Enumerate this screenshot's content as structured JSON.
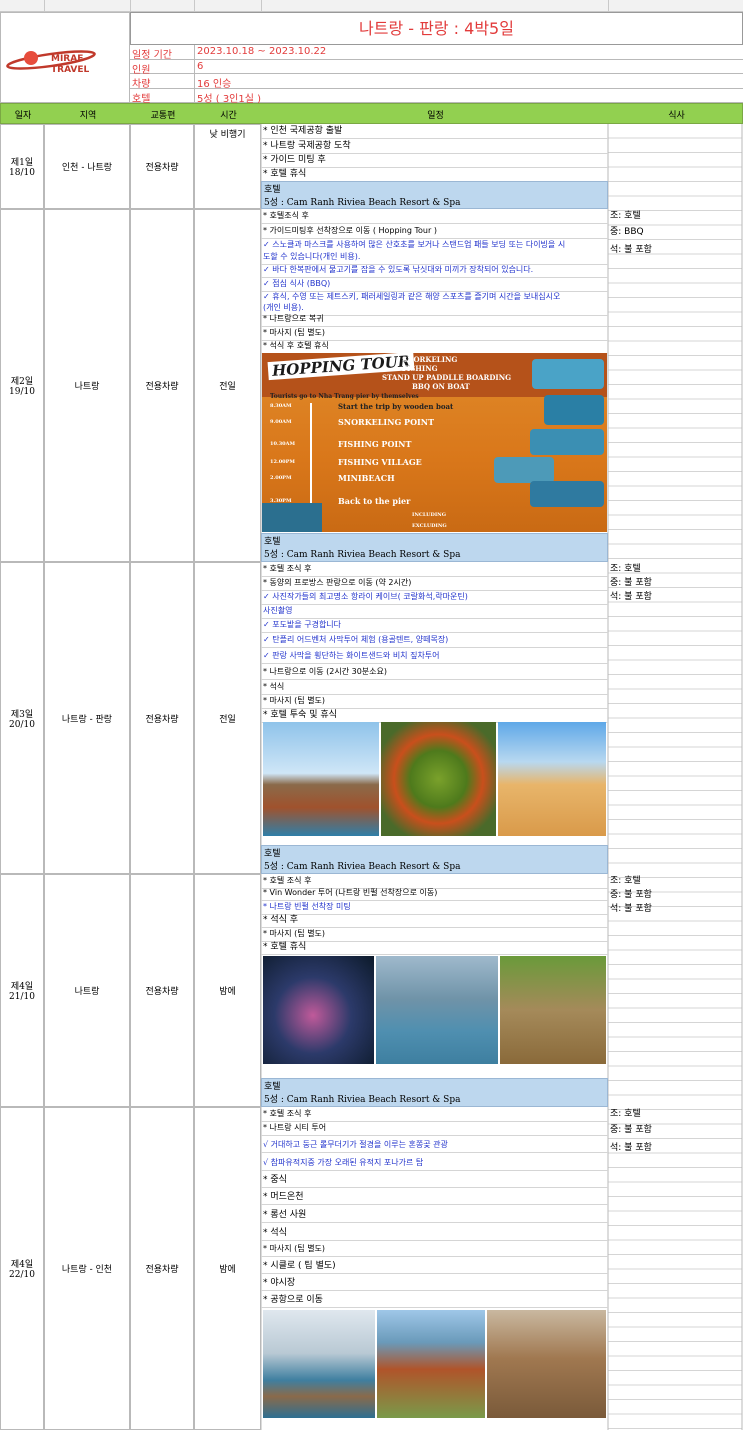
{
  "title": "나트랑 - 판랑 :  4박5일",
  "logo": {
    "line1": "MIRAE",
    "line2": "TRAVEL"
  },
  "info": [
    {
      "key": "일정 기간",
      "value": "2023.10.18 ~ 2023.10.22"
    },
    {
      "key": "인원",
      "value": "6"
    },
    {
      "key": "차량",
      "value": "16 인승"
    },
    {
      "key": "호텔",
      "value": "5성 ( 3인1실 )"
    }
  ],
  "columns": {
    "date": "일자",
    "region": "지역",
    "transport": "교통편",
    "time": "시간",
    "schedule": "일정",
    "meal": "식사"
  },
  "days": [
    {
      "date": "제1일\n18/10",
      "region": "인천 - 나트랑",
      "transport": "전용차량",
      "time": "낮 비행기",
      "items": [
        "* 인천 국제공항 출발",
        "* 나트랑 국제공항 도착",
        "* 가이드 미팅 후",
        "* 호텔 휴식"
      ],
      "hotel_label": "호텔",
      "hotel_name": "5성 :  Cam Ranh Riviea Beach Resort & Spa",
      "meals": []
    },
    {
      "date": "제2일\n19/10",
      "region": "나트랑",
      "transport": "전용차량",
      "time": "전일",
      "items": [
        "* 호텔조식 후",
        "* 가이드미팅후 선착장으로 이동 ( Hopping Tour )",
        "✓  스노클과 마스크를 사용하여 많은 산호초를 보거나 스탠드업 패들 보딩 또는 다이빙을 시",
        "도할 수 있습니다(개인 비용).",
        "✓  바다 한복판에서 물고기를 잡을 수 있도록 낚싯대와 미끼가 장착되어 있습니다.",
        "✓  점심 식사 (BBQ)",
        "✓  휴식, 수영 또는 제트스키, 패러세일링과 같은 해양 스포츠를 즐기며 시간을 보내십시오",
        "(개인 비용).",
        "* 나트랑으로 복귀",
        "* 마사지 (팁 별도)",
        "* 석식 후  호텔 휴식"
      ],
      "poster": {
        "title": "HOPPING TOUR",
        "lines": [
          "SNORKELING",
          "FISHING",
          "STAND UP PADDLLE BOARDING",
          "BBQ ON BOAT"
        ],
        "intro": "Tourists go to Nha Trang pier by themselves",
        "steps": [
          {
            "time": "8.30AM",
            "label": "Start the trip by wooden boat"
          },
          {
            "time": "9.00AM",
            "label": "SNORKELING POINT"
          },
          {
            "time": "10.30AM",
            "label": "FISHING POINT"
          },
          {
            "time": "12.00PM",
            "label": "FISHING VILLAGE"
          },
          {
            "time": "2.00PM",
            "label": "MINIBEACH"
          },
          {
            "time": "3.30PM",
            "label": "Back to the pier"
          }
        ],
        "including": "INCLUDING",
        "excluding": "EXCLUDING"
      },
      "hotel_label": "호텔",
      "hotel_name": "5성 :  Cam Ranh Riviea Beach Resort & Spa",
      "meals": [
        "조: 호텔",
        "중: BBQ",
        "석: 불 포함"
      ]
    },
    {
      "date": "제3일\n20/10",
      "region": "나트랑 - 판랑",
      "transport": "전용차량",
      "time": "전일",
      "items": [
        "* 호텔 조식 후",
        "* 동양의 프로방스 판랑으로 이동 (약 2시간)",
        "✓  사진작가들의 최고명소 항라이 케이브( 코랄화석,락마운틴)",
        "   사진촬영",
        "✓  포도밭을 구경합니다",
        "✓ 탄플리 어드벤처 사막투어 체험 (용골텐트, 양떼목장)",
        "✓  판랑 사막을 횡단하는 화이트샌드와 비치 짚차투어",
        "* 나트랑으로 이동 (2시간 30분소요)",
        "* 석식",
        "* 마사지 (팁 별도)",
        "* 호텔 투숙 및 휴식"
      ],
      "hotel_label": "호텔",
      "hotel_name": "5성 :  Cam Ranh Riviea Beach Resort & Spa",
      "meals": [
        "조: 호텔",
        "중: 불 포함",
        "석: 불 포함"
      ]
    },
    {
      "date": "제4일\n21/10",
      "region": "나트랑",
      "transport": "전용차량",
      "time": "밤에",
      "items": [
        "* 호텔 조식 후",
        "* Vin Wonder 투어 (나트랑 빈펄 선착장으로 이동)",
        "* 나트랑 빈펄 선착장 미팅",
        "* 석식 후",
        "* 마사지 (팁 별도)",
        "* 호텔 휴식"
      ],
      "hotel_label": "호텔",
      "hotel_name": "5성 :  Cam Ranh Riviea Beach Resort & Spa",
      "meals": [
        "조: 호텔",
        "중: 불 포함",
        "석: 불 포함"
      ]
    },
    {
      "date": "제4일\n22/10",
      "region": "나트랑 - 인천",
      "transport": "전용차량",
      "time": "밤에",
      "items": [
        "* 호텔 조식 후",
        "* 나트랑 시티 투어",
        "√ 거대하고 둥근 롤무더기가  절경을 이루는 혼쫑곶 관광",
        "√ 참파유적지중 가장 오래된 유적지 포나가르 탑",
        "* 중식",
        "* 머드온천",
        "* 롱선 사원",
        "* 석식",
        "* 마사지 (팁 별도)",
        "* 시클로 ( 팁 별도)",
        "* 야시장",
        "* 공항으로 이동"
      ],
      "meals": [
        "조: 호텔",
        "중: 불 포함",
        "석: 불 포함"
      ]
    }
  ]
}
